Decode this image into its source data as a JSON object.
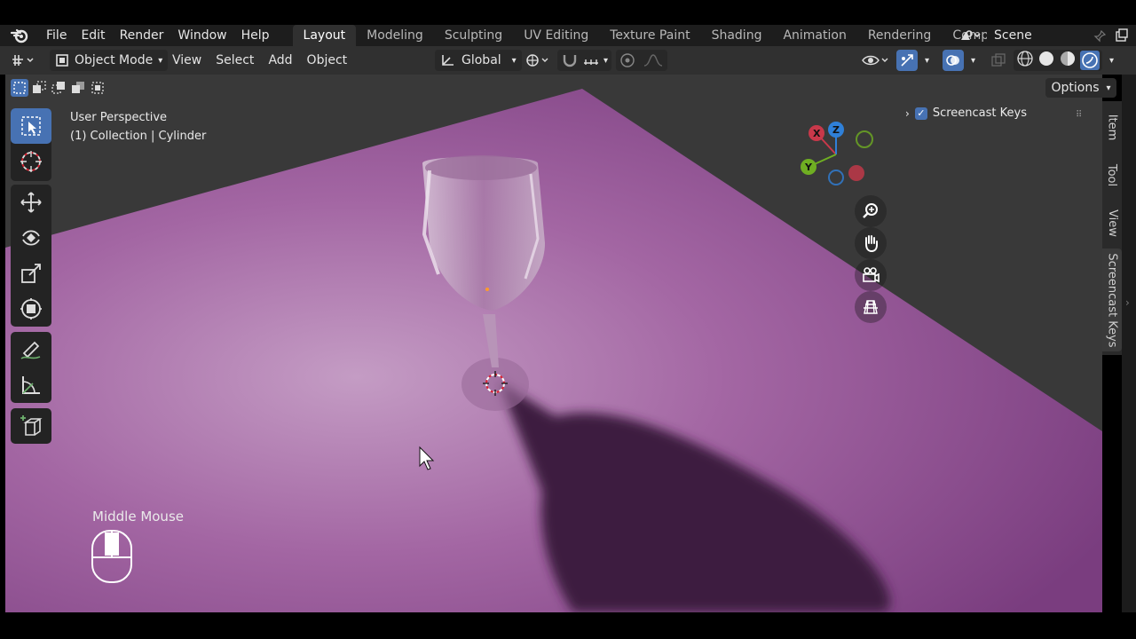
{
  "menu": {
    "items": [
      "File",
      "Edit",
      "Render",
      "Window",
      "Help"
    ]
  },
  "workspace_tabs": [
    "Layout",
    "Modeling",
    "Sculpting",
    "UV Editing",
    "Texture Paint",
    "Shading",
    "Animation",
    "Rendering",
    "Compositing"
  ],
  "active_tab": "Layout",
  "scene": {
    "name": "Scene"
  },
  "header": {
    "mode": "Object Mode",
    "menus": [
      "View",
      "Select",
      "Add",
      "Object"
    ],
    "transform_orientation": "Global"
  },
  "options_label": "Options",
  "viewport": {
    "perspective": "User Perspective",
    "collection": "(1) Collection | Cylinder"
  },
  "gizmo": {
    "x": "X",
    "y": "Y",
    "z": "Z"
  },
  "sidebar": {
    "tabs": [
      "Item",
      "Tool",
      "View",
      "Screencast Keys"
    ],
    "panel_label": "Screencast Keys"
  },
  "screencast": {
    "label": "Middle Mouse"
  },
  "colors": {
    "accent": "#4772b3",
    "plane": "#a366a3",
    "x_axis": "#c8384a",
    "y_axis": "#6fae22",
    "z_axis": "#2f80d8"
  }
}
